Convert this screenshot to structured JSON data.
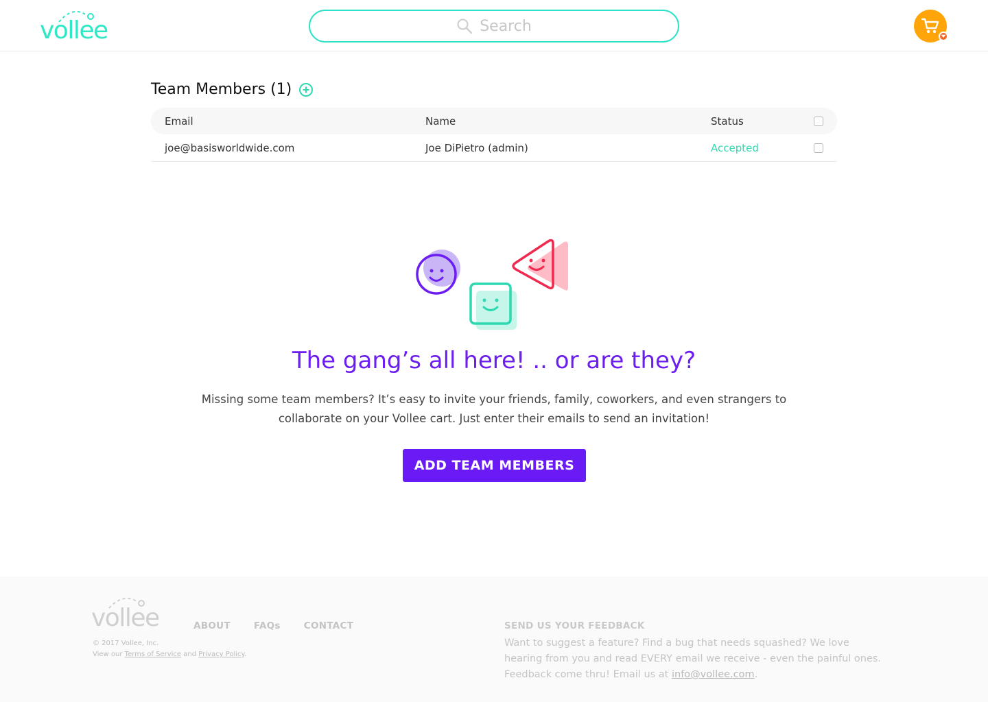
{
  "header": {
    "logo_text": "vollee",
    "search": {
      "placeholder": "Search",
      "icon": "search-icon"
    },
    "cart": {
      "icon": "cart-icon",
      "badge_icon": "chevron-down-icon",
      "color": "#ffa50a"
    }
  },
  "team": {
    "title": "Team Members (1)",
    "columns": {
      "email": "Email",
      "name": "Name",
      "status": "Status"
    },
    "rows": [
      {
        "email": "joe@basisworldwide.com",
        "name": "Joe DiPietro (admin)",
        "status": "Accepted"
      }
    ]
  },
  "empty_state": {
    "headline": "The gang’s all here! .. or are they?",
    "description": "Missing some team members? It’s easy to invite your friends, family, coworkers, and even strangers to collaborate on your Vollee cart. Just enter their emails to send an invitation!",
    "cta_label": "ADD TEAM MEMBERS"
  },
  "footer": {
    "logo_text": "vollee",
    "copyright": "© 2017 Vollee, Inc.",
    "view_prefix": "View our",
    "terms_label": "Terms of Service",
    "and_text": "and",
    "privacy_label": "Privacy Policy",
    "period": ".",
    "nav": [
      "ABOUT",
      "FAQs",
      "CONTACT"
    ],
    "feedback_title": "SEND US YOUR FEEDBACK",
    "feedback_text": "Want to suggest a feature? Find a bug that needs squashed? We love hearing from you and read EVERY email we receive - even the painful ones. Feedback come thru! Email us at",
    "feedback_email": "info@vollee.com",
    "feedback_end": "."
  },
  "colors": {
    "brand_teal": "#2ee8c6",
    "brand_purple": "#6a1bf5",
    "accepted_green": "#2ed8b0",
    "accent_pink": "#f0294f"
  }
}
